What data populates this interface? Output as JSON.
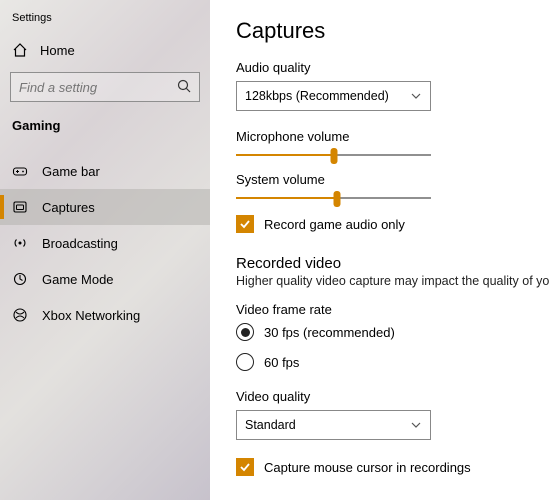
{
  "window_title": "Settings",
  "sidebar": {
    "home": "Home",
    "search_placeholder": "Find a setting",
    "category": "Gaming",
    "items": [
      {
        "label": "Game bar"
      },
      {
        "label": "Captures"
      },
      {
        "label": "Broadcasting"
      },
      {
        "label": "Game Mode"
      },
      {
        "label": "Xbox Networking"
      }
    ]
  },
  "main": {
    "title": "Captures",
    "audio_quality": {
      "label": "Audio quality",
      "value": "128kbps (Recommended)"
    },
    "mic_volume": {
      "label": "Microphone volume",
      "value_pct": 50
    },
    "sys_volume": {
      "label": "System volume",
      "value_pct": 52
    },
    "record_audio_only": {
      "label": "Record game audio only",
      "checked": true
    },
    "recorded_section": {
      "heading": "Recorded video",
      "desc": "Higher quality video capture may impact the quality of your game."
    },
    "frame_rate": {
      "label": "Video frame rate",
      "options": [
        {
          "label": "30 fps (recommended)",
          "selected": true
        },
        {
          "label": "60 fps",
          "selected": false
        }
      ]
    },
    "video_quality": {
      "label": "Video quality",
      "value": "Standard"
    },
    "capture_cursor": {
      "label": "Capture mouse cursor in recordings",
      "checked": true
    }
  },
  "colors": {
    "accent": "#d48500"
  }
}
